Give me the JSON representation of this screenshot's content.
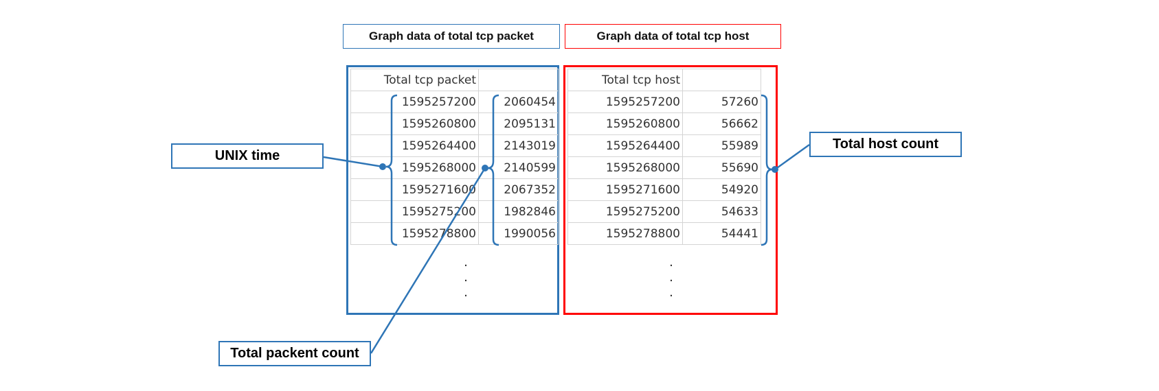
{
  "titles": {
    "total_tcp_packet": "Graph data of total tcp packet",
    "total_tcp_host": "Graph data of total tcp host"
  },
  "packet_table": {
    "header": "Total tcp packet",
    "rows": [
      [
        "1595257200",
        "2060454"
      ],
      [
        "1595260800",
        "2095131"
      ],
      [
        "1595264400",
        "2143019"
      ],
      [
        "1595268000",
        "2140599"
      ],
      [
        "1595271600",
        "2067352"
      ],
      [
        "1595275200",
        "1982846"
      ],
      [
        "1595278800",
        "1990056"
      ]
    ]
  },
  "host_table": {
    "header": "Total tcp host",
    "rows": [
      [
        "1595257200",
        "57260"
      ],
      [
        "1595260800",
        "56662"
      ],
      [
        "1595264400",
        "55989"
      ],
      [
        "1595268000",
        "55690"
      ],
      [
        "1595271600",
        "54920"
      ],
      [
        "1595275200",
        "54633"
      ],
      [
        "1595278800",
        "54441"
      ]
    ]
  },
  "ellipsis": ".",
  "callouts": {
    "unix_time": "UNIX time",
    "total_packet_count": "Total packent count",
    "total_host_count": "Total host count"
  },
  "colors": {
    "packet_frame": "#2E75B6",
    "host_frame": "#FF0000",
    "callout": "#2E75B6"
  }
}
